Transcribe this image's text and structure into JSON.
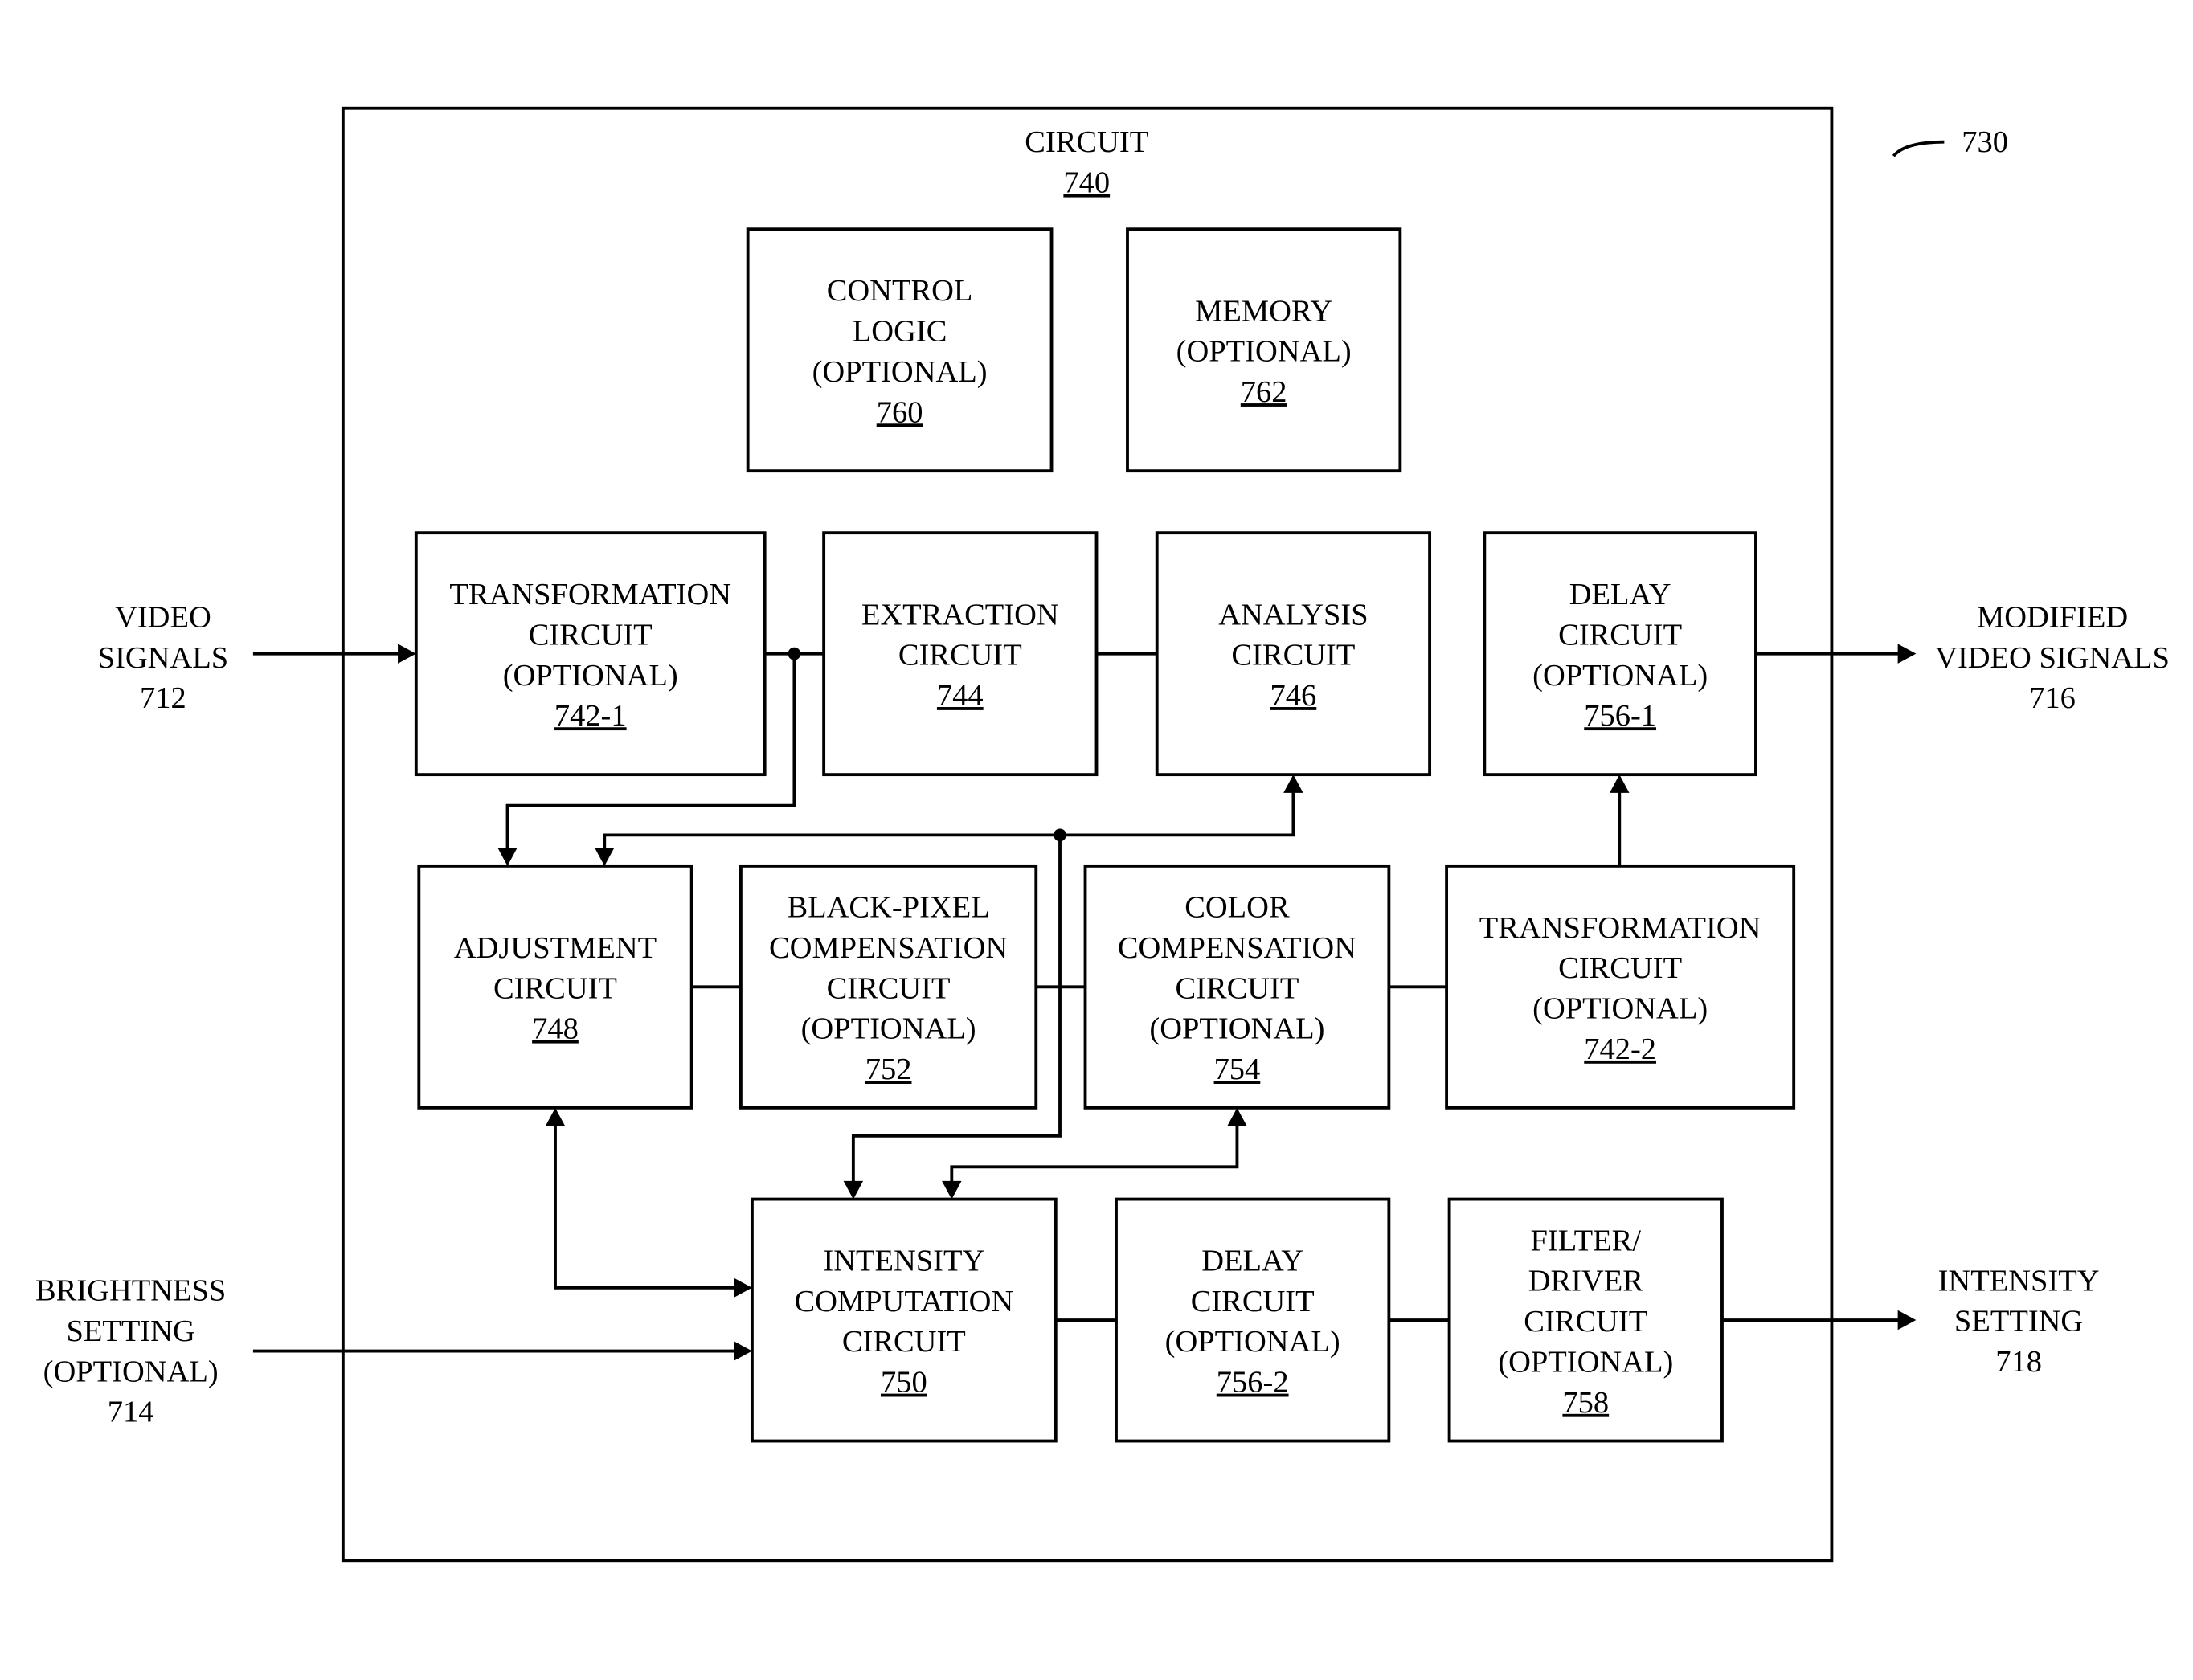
{
  "figure": {
    "reference": "730",
    "container": {
      "title": "CIRCUIT",
      "ref": "740"
    }
  },
  "blocks": {
    "control_logic": {
      "lines": [
        "CONTROL",
        "LOGIC",
        "(OPTIONAL)"
      ],
      "ref": "760"
    },
    "memory": {
      "lines": [
        "MEMORY",
        "(OPTIONAL)"
      ],
      "ref": "762"
    },
    "transformation_1": {
      "lines": [
        "TRANSFORMATION",
        "CIRCUIT",
        "(OPTIONAL)"
      ],
      "ref": "742-1"
    },
    "extraction": {
      "lines": [
        "EXTRACTION",
        "CIRCUIT"
      ],
      "ref": "744"
    },
    "analysis": {
      "lines": [
        "ANALYSIS",
        "CIRCUIT"
      ],
      "ref": "746"
    },
    "delay_1": {
      "lines": [
        "DELAY",
        "CIRCUIT",
        "(OPTIONAL)"
      ],
      "ref": "756-1"
    },
    "adjustment": {
      "lines": [
        "ADJUSTMENT",
        "CIRCUIT"
      ],
      "ref": "748"
    },
    "black_pixel": {
      "lines": [
        "BLACK-PIXEL",
        "COMPENSATION",
        "CIRCUIT",
        "(OPTIONAL)"
      ],
      "ref": "752"
    },
    "color_comp": {
      "lines": [
        "COLOR",
        "COMPENSATION",
        "CIRCUIT",
        "(OPTIONAL)"
      ],
      "ref": "754"
    },
    "transformation_2": {
      "lines": [
        "TRANSFORMATION",
        "CIRCUIT",
        "(OPTIONAL)"
      ],
      "ref": "742-2"
    },
    "intensity_comp": {
      "lines": [
        "INTENSITY",
        "COMPUTATION",
        "CIRCUIT"
      ],
      "ref": "750"
    },
    "delay_2": {
      "lines": [
        "DELAY",
        "CIRCUIT",
        "(OPTIONAL)"
      ],
      "ref": "756-2"
    },
    "filter_driver": {
      "lines": [
        "FILTER/",
        "DRIVER",
        "CIRCUIT",
        "(OPTIONAL)"
      ],
      "ref": "758"
    }
  },
  "external": {
    "video_in": {
      "lines": [
        "VIDEO",
        "SIGNALS",
        "712"
      ]
    },
    "brightness_in": {
      "lines": [
        "BRIGHTNESS",
        "SETTING",
        "(OPTIONAL)",
        "714"
      ]
    },
    "video_out": {
      "lines": [
        "MODIFIED",
        "VIDEO SIGNALS",
        "716"
      ]
    },
    "intensity_out": {
      "lines": [
        "INTENSITY",
        "SETTING",
        "718"
      ]
    }
  }
}
